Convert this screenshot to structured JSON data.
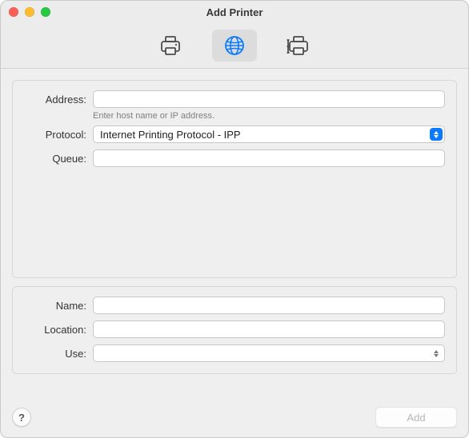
{
  "window": {
    "title": "Add Printer"
  },
  "tabs": {
    "default_label": "Default",
    "ip_label": "IP",
    "windows_label": "Windows",
    "selected": "ip"
  },
  "form": {
    "address": {
      "label": "Address:",
      "value": "",
      "hint": "Enter host name or IP address."
    },
    "protocol": {
      "label": "Protocol:",
      "value": "Internet Printing Protocol - IPP"
    },
    "queue": {
      "label": "Queue:",
      "value": ""
    },
    "name": {
      "label": "Name:",
      "value": ""
    },
    "location": {
      "label": "Location:",
      "value": ""
    },
    "use": {
      "label": "Use:",
      "value": ""
    }
  },
  "footer": {
    "help_label": "?",
    "add_label": "Add",
    "add_enabled": false
  },
  "colors": {
    "accent": "#0a7bff"
  }
}
